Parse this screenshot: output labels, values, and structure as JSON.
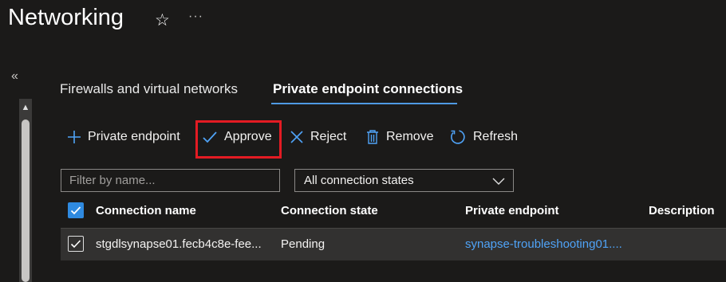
{
  "page": {
    "title": "Networking"
  },
  "tabs": [
    {
      "label": "Firewalls and virtual networks"
    },
    {
      "label": "Private endpoint connections"
    }
  ],
  "toolbar": {
    "add_label": "Private endpoint",
    "approve_label": "Approve",
    "reject_label": "Reject",
    "remove_label": "Remove",
    "refresh_label": "Refresh"
  },
  "filters": {
    "search_placeholder": "Filter by name...",
    "search_value": "",
    "state_selected": "All connection states"
  },
  "table": {
    "columns": [
      "Connection name",
      "Connection state",
      "Private endpoint",
      "Description"
    ],
    "rows": [
      {
        "selected": true,
        "name": "stgdlsynapse01.fecb4c8e-fee...",
        "state": "Pending",
        "endpoint": "synapse-troubleshooting01....",
        "description": ""
      }
    ]
  },
  "colors": {
    "background": "#1b1a19",
    "accent": "#2f8ae0",
    "link": "#4fa3f7",
    "highlight": "#e31b23",
    "row_background": "#323130"
  },
  "icons": {
    "favorite": "star-icon",
    "more": "more-icon",
    "collapse": "double-chevron-left-icon",
    "add": "plus-icon",
    "approve": "checkmark-icon",
    "reject": "x-icon",
    "remove": "trash-icon",
    "refresh": "refresh-icon",
    "dropdown": "chevron-down-icon"
  }
}
